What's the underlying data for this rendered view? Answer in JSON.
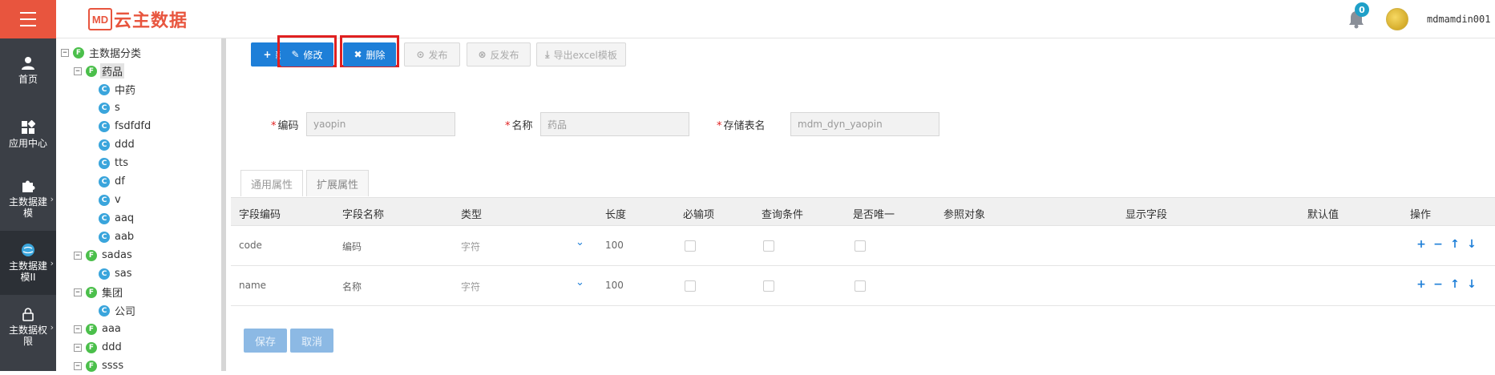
{
  "header": {
    "logo_mark": "MD",
    "logo_text": "云主数据",
    "notification_count": "0",
    "username": "mdmamdin001"
  },
  "leftnav": {
    "items": [
      {
        "label": "首页",
        "icon": "user-icon"
      },
      {
        "label": "应用中心",
        "icon": "apps-icon"
      },
      {
        "label": "主数据建模",
        "icon": "puzzle-icon"
      },
      {
        "label": "主数据建模II",
        "icon": "globe-icon"
      },
      {
        "label": "主数据权限",
        "icon": "lock-icon"
      }
    ]
  },
  "tree": {
    "root": "主数据分类",
    "nodes": [
      {
        "label": "药品",
        "level": 1,
        "type": "F",
        "toggle": "−"
      },
      {
        "label": "中药",
        "level": 2,
        "type": "C"
      },
      {
        "label": "s",
        "level": 2,
        "type": "C"
      },
      {
        "label": "fsdfdfd",
        "level": 2,
        "type": "C"
      },
      {
        "label": "ddd",
        "level": 2,
        "type": "C"
      },
      {
        "label": "tts",
        "level": 2,
        "type": "C"
      },
      {
        "label": "df",
        "level": 2,
        "type": "C"
      },
      {
        "label": "v",
        "level": 2,
        "type": "C"
      },
      {
        "label": "aaq",
        "level": 2,
        "type": "C"
      },
      {
        "label": "aab",
        "level": 2,
        "type": "C"
      },
      {
        "label": "sadas",
        "level": 1,
        "type": "F",
        "toggle": "−"
      },
      {
        "label": "sas",
        "level": 2,
        "type": "C"
      },
      {
        "label": "集团",
        "level": 1,
        "type": "F",
        "toggle": "−"
      },
      {
        "label": "公司",
        "level": 2,
        "type": "C"
      },
      {
        "label": "aaa",
        "level": 1,
        "type": "F",
        "toggle": "−"
      },
      {
        "label": "ddd",
        "level": 1,
        "type": "F",
        "toggle": "−"
      },
      {
        "label": "ssss",
        "level": 1,
        "type": "F",
        "toggle": "−"
      }
    ]
  },
  "toolbar": {
    "add": "新增",
    "edit": "修改",
    "delete": "删除",
    "publish": "发布",
    "unpublish": "反发布",
    "export": "导出excel模板"
  },
  "form": {
    "code_label": "编码",
    "code_value": "yaopin",
    "name_label": "名称",
    "name_value": "药品",
    "table_label": "存储表名",
    "table_value": "mdm_dyn_yaopin"
  },
  "tabs": [
    "通用属性",
    "扩展属性"
  ],
  "grid": {
    "columns": [
      "字段编码",
      "字段名称",
      "类型",
      "长度",
      "必输项",
      "查询条件",
      "是否唯一",
      "参照对象",
      "显示字段",
      "默认值",
      "操作"
    ],
    "rows": [
      {
        "code": "code",
        "name": "编码",
        "type": "字符",
        "length": "100"
      },
      {
        "code": "name",
        "name": "名称",
        "type": "字符",
        "length": "100"
      }
    ]
  },
  "footer": {
    "save": "保存",
    "cancel": "取消"
  },
  "colors": {
    "brand": "#e8553e",
    "primary": "#1e7fd8",
    "nav_bg": "#3b3f46",
    "highlight": "#e02020"
  }
}
